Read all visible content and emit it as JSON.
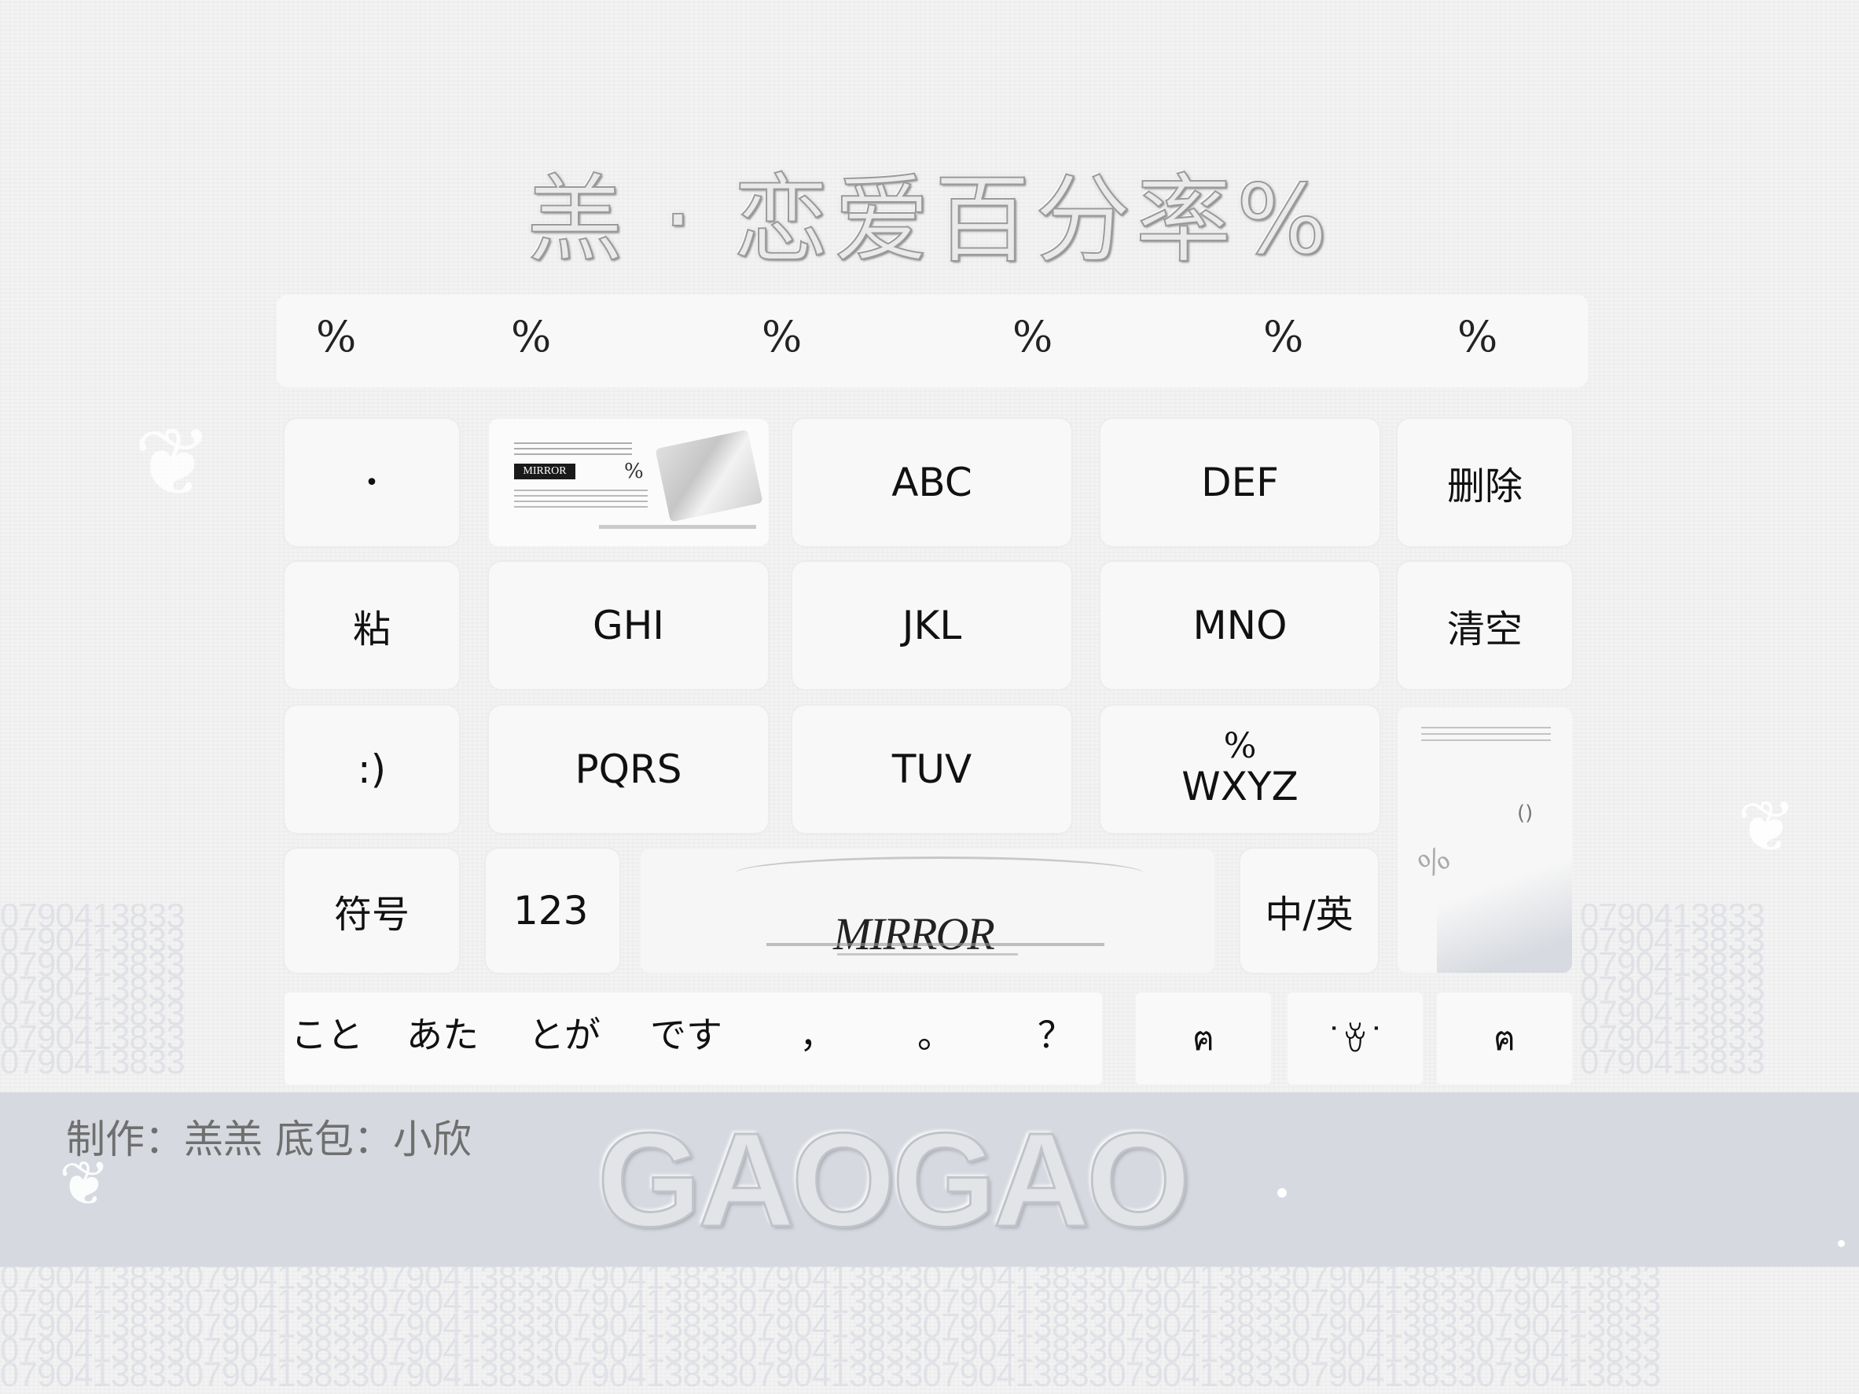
{
  "title": "羔 · 恋爱百分率%",
  "percent_row": [
    "%",
    "%",
    "%",
    "%",
    "%",
    "%"
  ],
  "keys": {
    "dot": "•",
    "abc": "ABC",
    "def": "DEF",
    "delete": "删除",
    "paste": "粘",
    "ghi": "GHI",
    "jkl": "JKL",
    "mno": "MNO",
    "clear": "清空",
    "smile": ":)",
    "pqrs": "PQRS",
    "tuv": "TUV",
    "wxyz_pct": "%",
    "wxyz": "WXYZ",
    "symbol": "符号",
    "num": "123",
    "lang": "中/英"
  },
  "ad_card": {
    "brand": "MIRROR",
    "pct": "%"
  },
  "mirror_card": {
    "word": "MIRROR"
  },
  "side_card": {
    "paren": "()",
    "pct": "%"
  },
  "suggestions": [
    "こと",
    "あた",
    "とが",
    "です",
    "，",
    "。",
    "？"
  ],
  "emoji_keys": [
    "ฅ",
    "˙ꈊ˙",
    "ฅ"
  ],
  "credits": "制作：羔羔 底包：小欣",
  "logo": "GAOGAO",
  "pattern_text": "0790413833"
}
